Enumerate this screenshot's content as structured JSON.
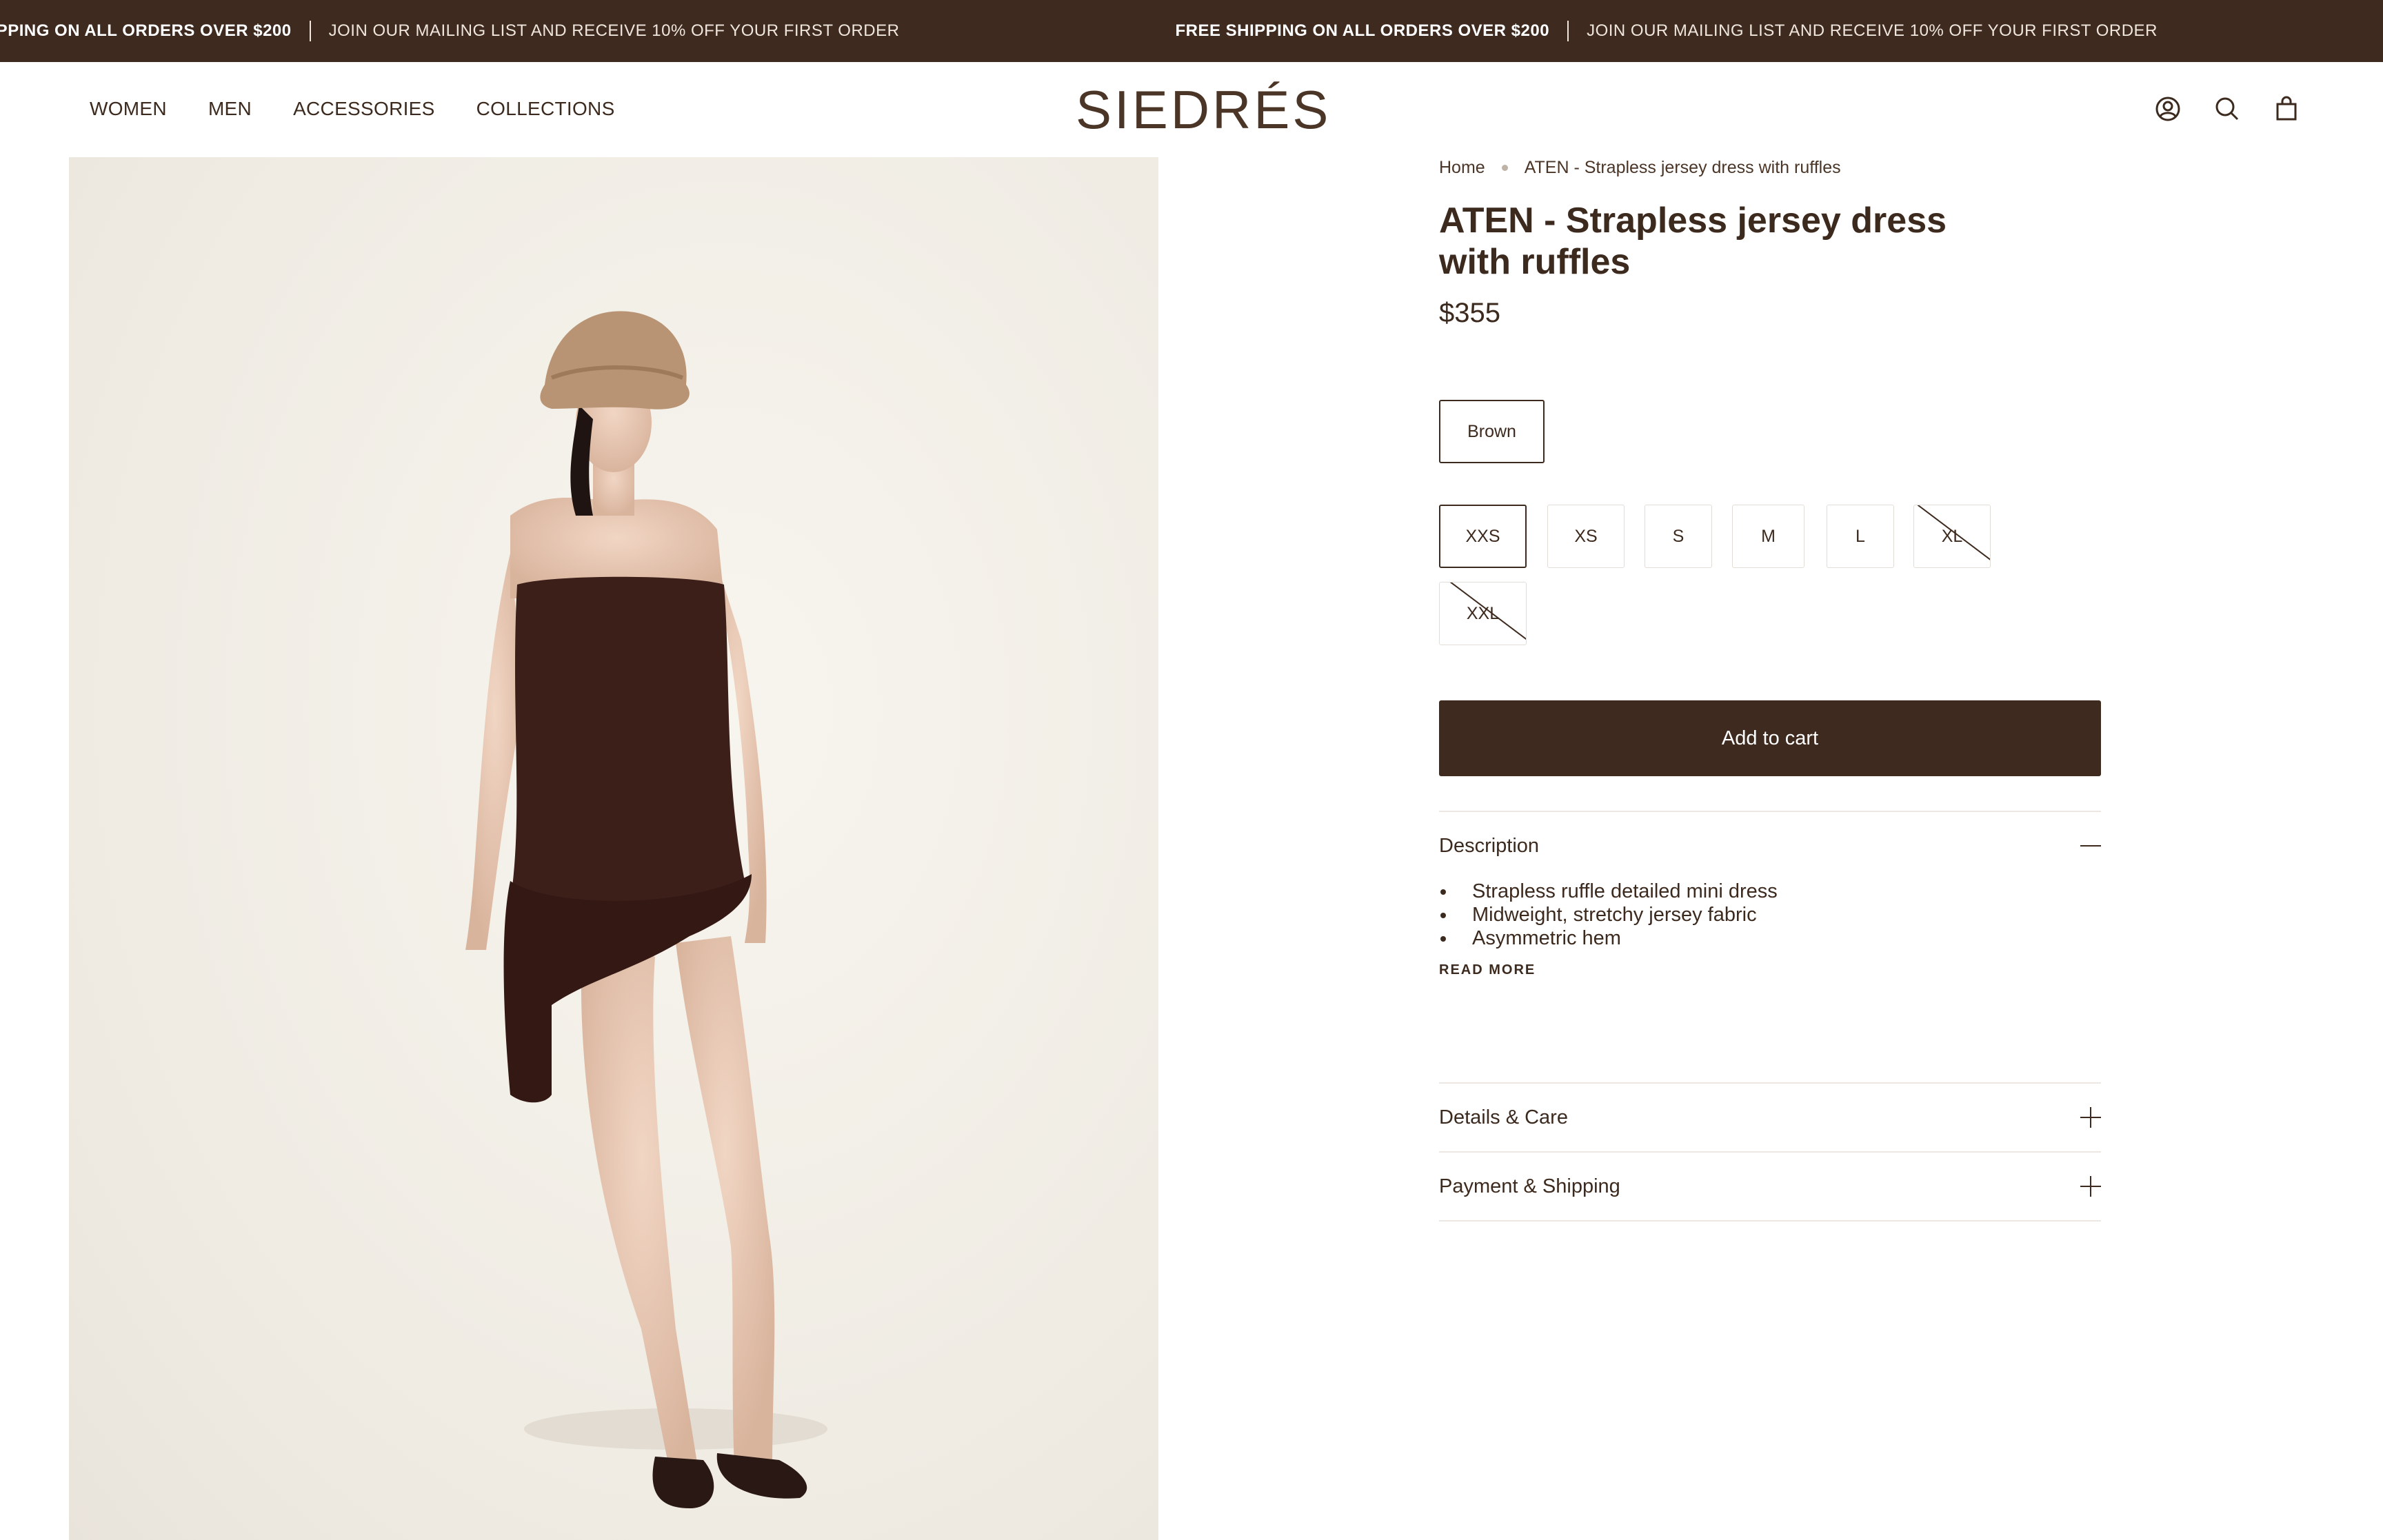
{
  "announcement": {
    "shipping": "FREE SHIPPING ON ALL ORDERS OVER $200",
    "mailing": "JOIN OUR MAILING LIST AND RECEIVE 10% OFF YOUR FIRST ORDER"
  },
  "header": {
    "nav": [
      "WOMEN",
      "MEN",
      "ACCESSORIES",
      "COLLECTIONS"
    ],
    "logo": "SIEDRÉS",
    "icons": [
      "account-icon",
      "search-icon",
      "bag-icon"
    ]
  },
  "breadcrumb": {
    "home": "Home",
    "current": "ATEN - Strapless jersey dress with ruffles"
  },
  "product": {
    "title": "ATEN - Strapless jersey dress with ruffles",
    "price": "$355",
    "color": "Brown",
    "sizes": [
      {
        "label": "XXS",
        "selected": true,
        "available": true
      },
      {
        "label": "XS",
        "selected": false,
        "available": true
      },
      {
        "label": "S",
        "selected": false,
        "available": true
      },
      {
        "label": "M",
        "selected": false,
        "available": true
      },
      {
        "label": "L",
        "selected": false,
        "available": true
      },
      {
        "label": "XL",
        "selected": false,
        "available": false
      },
      {
        "label": "XXL",
        "selected": false,
        "available": false
      }
    ],
    "add_to_cart": "Add to cart"
  },
  "accordions": {
    "description": {
      "label": "Description",
      "items": [
        "Strapless ruffle detailed mini dress",
        "Midweight, stretchy jersey fabric",
        "Asymmetric hem"
      ],
      "read_more": "READ MORE"
    },
    "details": {
      "label": "Details & Care"
    },
    "payment": {
      "label": "Payment & Shipping"
    }
  },
  "colors": {
    "brand_dark": "#3e2a1f",
    "text": "#3d2a1e"
  }
}
